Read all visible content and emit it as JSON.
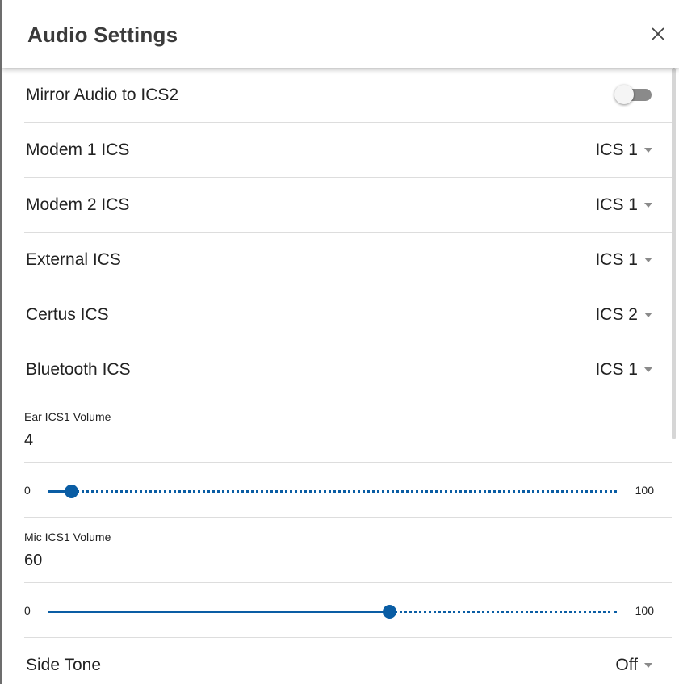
{
  "header": {
    "title": "Audio Settings",
    "close_icon": "close-icon"
  },
  "mirror": {
    "label": "Mirror Audio to ICS2",
    "on": false
  },
  "routing": [
    {
      "label": "Modem 1 ICS",
      "value": "ICS 1"
    },
    {
      "label": "Modem 2 ICS",
      "value": "ICS 1"
    },
    {
      "label": "External ICS",
      "value": "ICS 1"
    },
    {
      "label": "Certus ICS",
      "value": "ICS 2"
    },
    {
      "label": "Bluetooth ICS",
      "value": "ICS 1"
    }
  ],
  "ear_volume": {
    "label": "Ear ICS1 Volume",
    "value": "4",
    "min": "0",
    "max": "100",
    "level": 4
  },
  "mic_volume": {
    "label": "Mic ICS1 Volume",
    "value": "60",
    "min": "0",
    "max": "100",
    "level": 60
  },
  "side_tone": {
    "label": "Side Tone",
    "value": "Off"
  },
  "colors": {
    "accent": "#0a5da4",
    "toggle_off": "#8a8a8a"
  }
}
